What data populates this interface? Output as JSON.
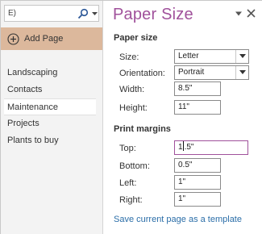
{
  "search": {
    "value": "E)"
  },
  "pages": {
    "add_label": "Add Page",
    "items": [
      {
        "label": "Landscaping"
      },
      {
        "label": "Contacts"
      },
      {
        "label": "Maintenance"
      },
      {
        "label": "Projects"
      },
      {
        "label": "Plants to buy"
      }
    ],
    "selected_index": 2
  },
  "pane": {
    "title": "Paper Size",
    "paper_size": {
      "heading": "Paper size",
      "size_label": "Size:",
      "size_value": "Letter",
      "orientation_label": "Orientation:",
      "orientation_value": "Portrait",
      "width_label": "Width:",
      "width_value": "8.5\"",
      "height_label": "Height:",
      "height_value": "11\""
    },
    "margins": {
      "heading": "Print margins",
      "top_label": "Top:",
      "top_before_caret": "1",
      "top_after_caret": ".5\"",
      "bottom_label": "Bottom:",
      "bottom_value": "0.5\"",
      "left_label": "Left:",
      "left_value": "1\"",
      "right_label": "Right:",
      "right_value": "1\""
    },
    "template_link": "Save current page as a template"
  },
  "colors": {
    "accent": "#a0519b",
    "add_page_bg": "#dcb89c",
    "link": "#2b6ea8",
    "left_bg": "#f3f3f3"
  }
}
